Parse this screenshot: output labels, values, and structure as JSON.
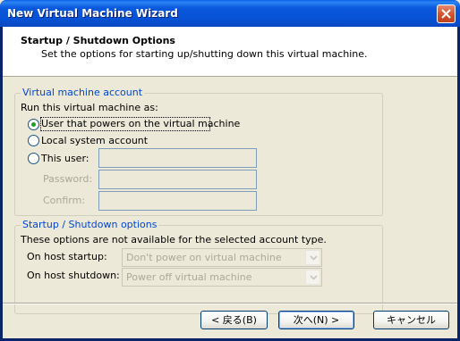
{
  "window": {
    "title": "New Virtual Machine Wizard"
  },
  "header": {
    "title": "Startup / Shutdown Options",
    "subtitle": "Set the options for starting up/shutting down this virtual machine."
  },
  "account_group": {
    "legend": "Virtual machine account",
    "prompt": "Run this virtual machine as:",
    "options": [
      {
        "label": "User that powers on the virtual machine",
        "checked": true
      },
      {
        "label": "Local system account",
        "checked": false
      },
      {
        "label": "This user:",
        "checked": false
      }
    ],
    "user_value": "",
    "password_label": "Password:",
    "password_value": "",
    "confirm_label": "Confirm:",
    "confirm_value": ""
  },
  "options_group": {
    "legend": "Startup / Shutdown options",
    "note": "These options are not available for the selected account type.",
    "startup_label": "On host startup:",
    "startup_value": "Don't power on virtual machine",
    "shutdown_label": "On host shutdown:",
    "shutdown_value": "Power off virtual machine"
  },
  "buttons": {
    "back": "< 戻る(B)",
    "next": "次へ(N) >",
    "cancel": "キャンセル"
  },
  "colors": {
    "titlebar": "#0752d6",
    "legend": "#0046d5",
    "radio_dot": "#21a121"
  }
}
